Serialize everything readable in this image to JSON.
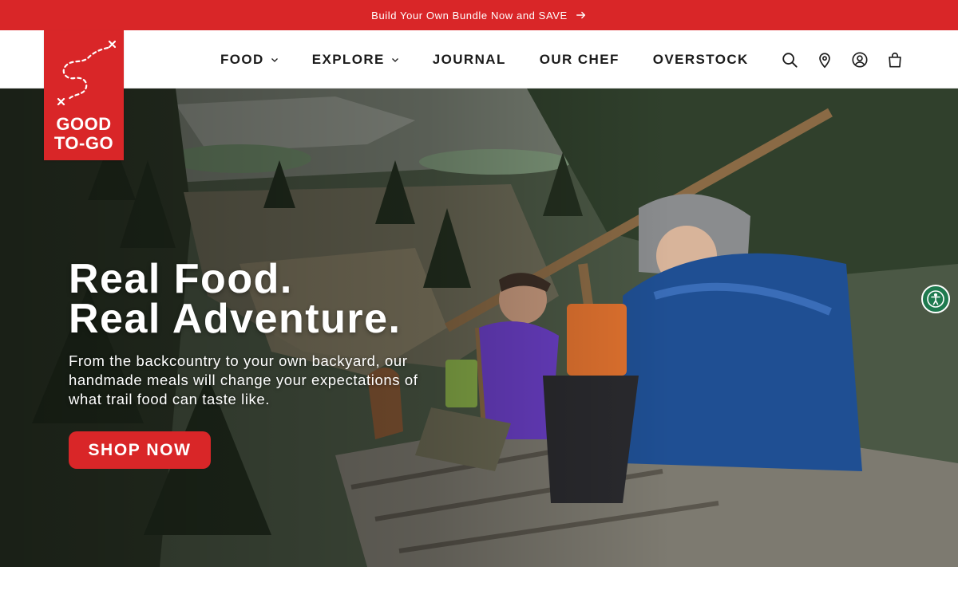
{
  "announcement": {
    "text": "Build Your Own Bundle Now and SAVE",
    "arrow_icon": "arrow-right-icon"
  },
  "brand": {
    "name_line1": "GOOD",
    "name_line2": "TO-GO",
    "color": "#d92628"
  },
  "nav": {
    "items": [
      {
        "label": "FOOD",
        "has_dropdown": true
      },
      {
        "label": "EXPLORE",
        "has_dropdown": true
      },
      {
        "label": "JOURNAL",
        "has_dropdown": false
      },
      {
        "label": "OUR CHEF",
        "has_dropdown": false
      },
      {
        "label": "OVERSTOCK",
        "has_dropdown": false
      }
    ]
  },
  "header_icons": [
    "search-icon",
    "location-pin-icon",
    "account-icon",
    "cart-bag-icon"
  ],
  "hero": {
    "headline_line1": "Real Food.",
    "headline_line2": "Real Adventure.",
    "subtext": "From the backcountry to your own backyard, our handmade meals will change your expectations of what trail food can taste like.",
    "cta_label": "SHOP NOW"
  },
  "accessibility_widget": {
    "icon": "accessibility-icon",
    "color": "#1f7a4f"
  }
}
